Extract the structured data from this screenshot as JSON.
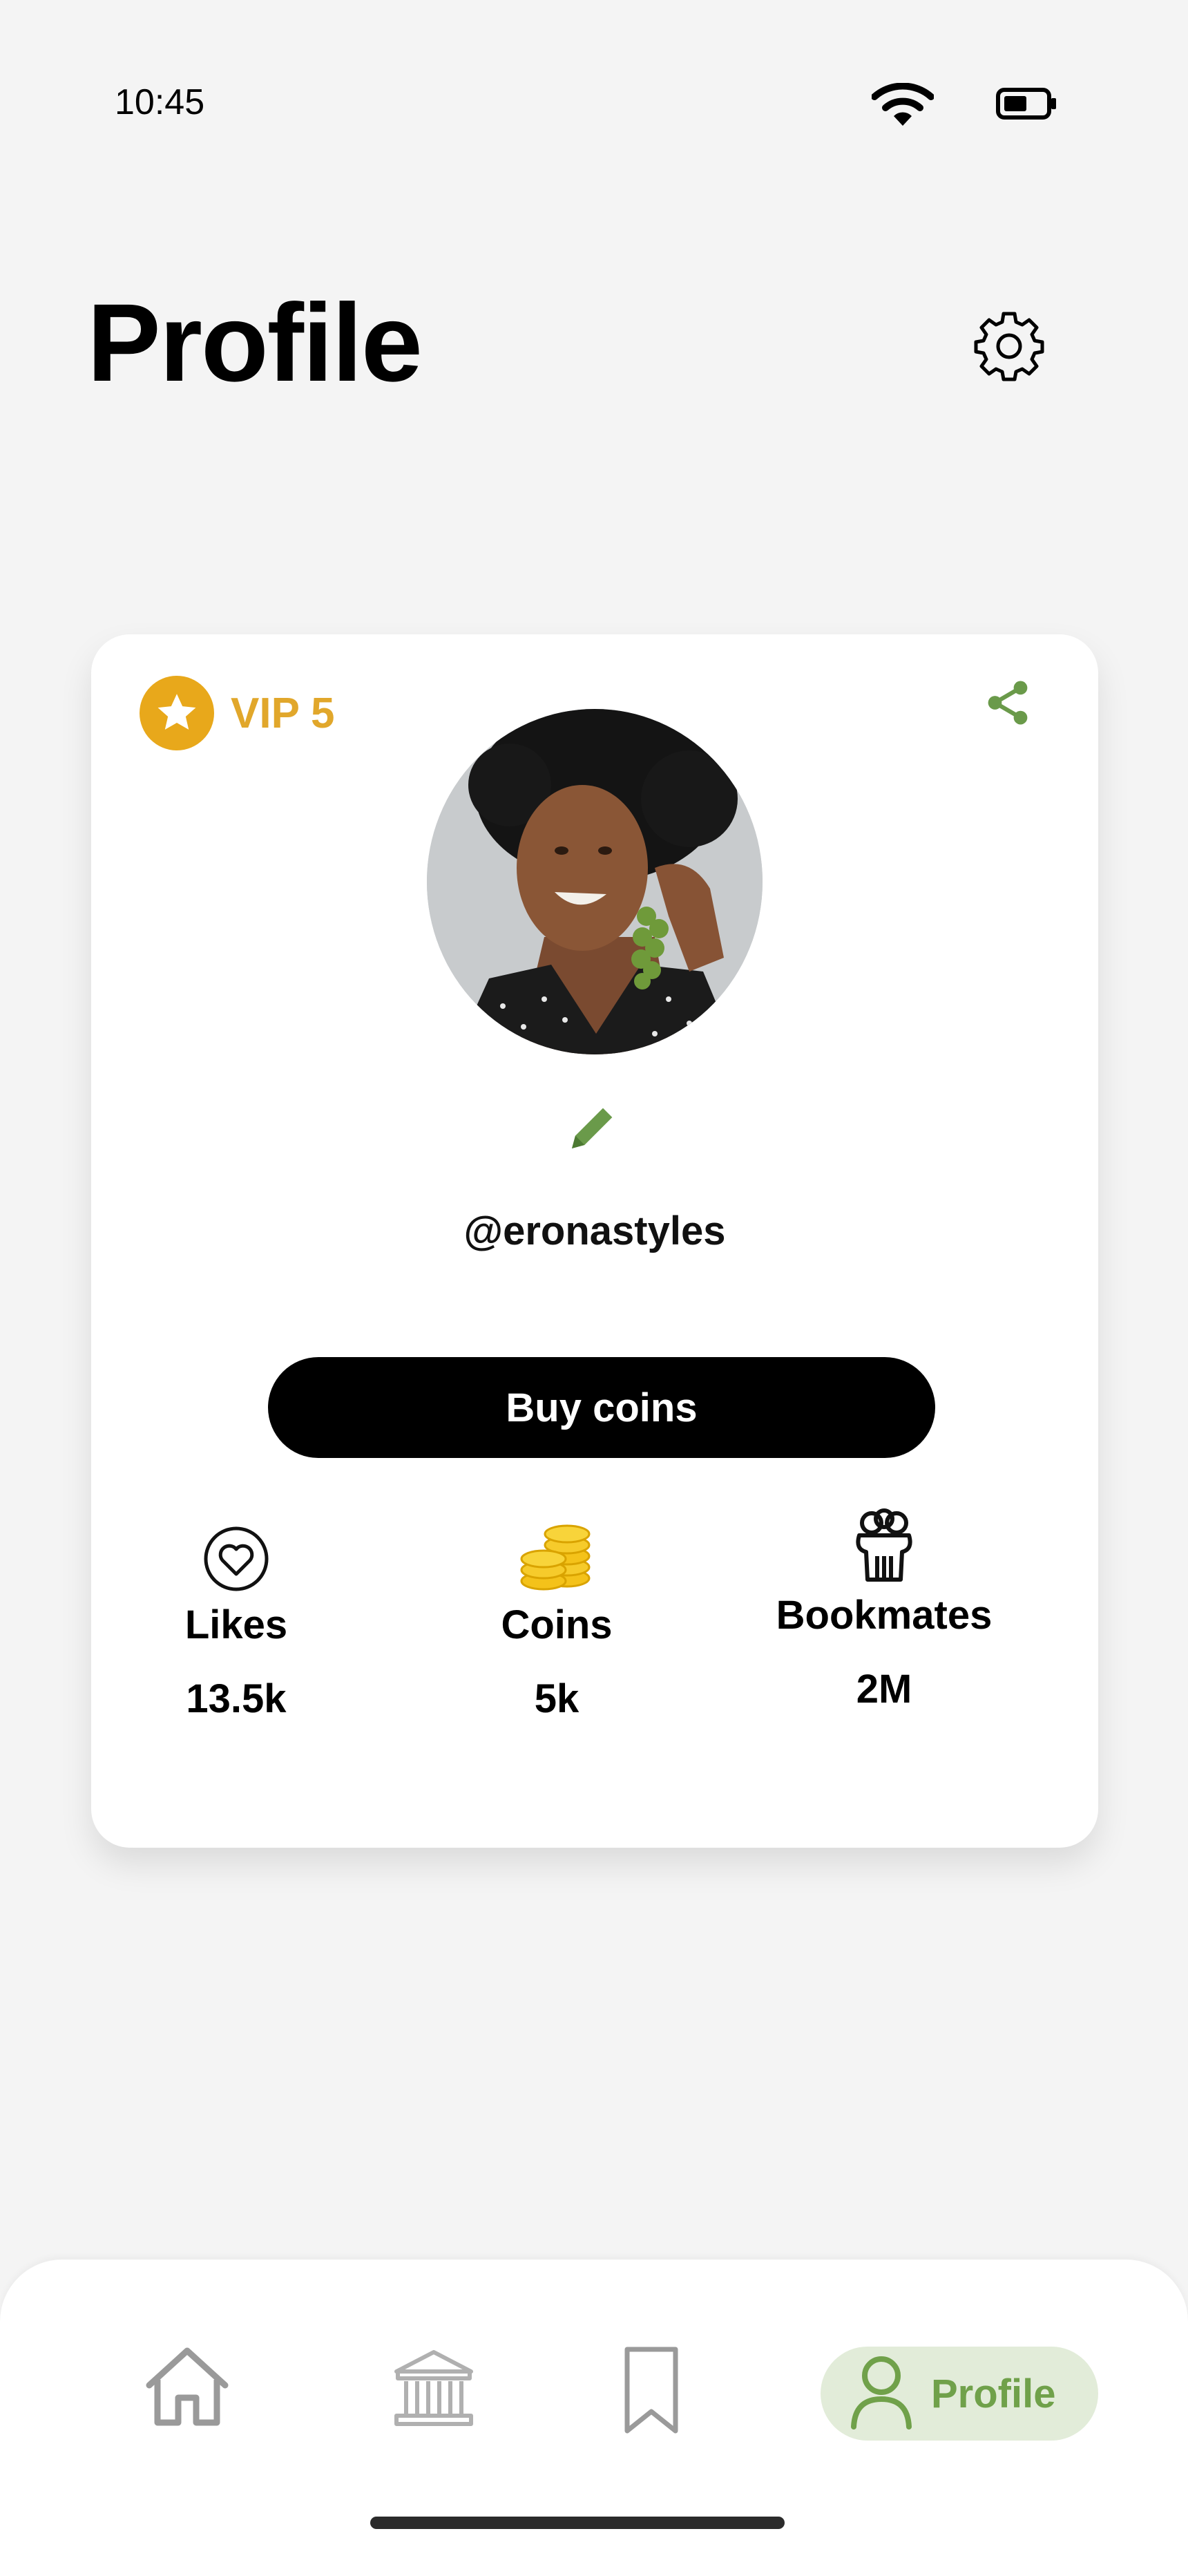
{
  "status_bar": {
    "time": "10:45",
    "wifi_icon": "wifi-icon",
    "battery_icon": "battery-icon"
  },
  "header": {
    "title": "Profile",
    "settings_icon": "gear-icon"
  },
  "profile_card": {
    "vip_label": "VIP 5",
    "vip_icon": "star-icon",
    "share_icon": "share-icon",
    "edit_icon": "pencil-icon",
    "username": "@eronastyles",
    "buy_button_label": "Buy coins",
    "stats": [
      {
        "label": "Likes",
        "value": "13.5k",
        "icon": "heart-icon"
      },
      {
        "label": "Coins",
        "value": "5k",
        "icon": "coins-icon"
      },
      {
        "label": "Bookmates",
        "value": "2M",
        "icon": "bookmates-icon"
      }
    ]
  },
  "bottom_nav": {
    "items": [
      {
        "icon": "home-icon"
      },
      {
        "icon": "library-icon"
      },
      {
        "icon": "bookmark-icon"
      },
      {
        "icon": "profile-icon",
        "label": "Profile",
        "active": true
      }
    ]
  },
  "colors": {
    "accent_green": "#70a14a",
    "vip_gold": "#e1a72b",
    "active_pill": "#e2ecd9"
  }
}
